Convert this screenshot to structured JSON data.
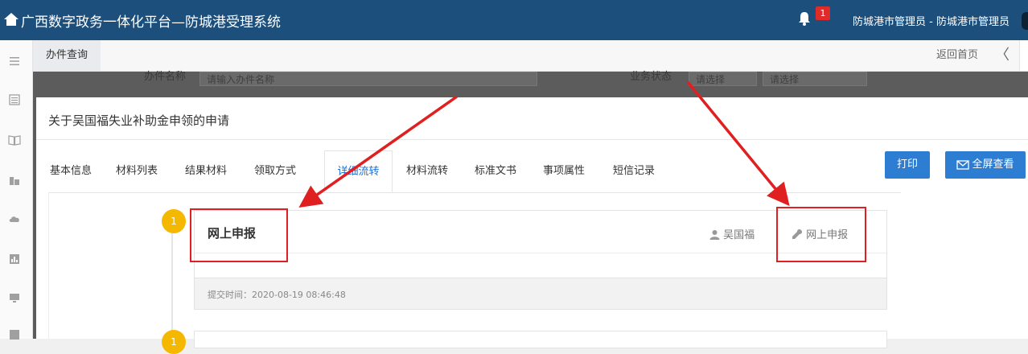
{
  "header": {
    "title": "广西数字政务一体化平台—防城港受理系统",
    "notification_count": "1",
    "user": "防城港市管理员 - 防城港市管理员"
  },
  "left_rail": {
    "icons": [
      "menu-icon",
      "list-icon",
      "book-icon",
      "building-icon",
      "cloud-icon",
      "chart-icon",
      "monitor-icon",
      "report-icon"
    ]
  },
  "tab_strip": {
    "active_tab": "办件查询",
    "home_link": "返回首页",
    "prev_arrow": "〈"
  },
  "background_form": {
    "name_label": "办件名称",
    "name_placeholder": "请输入办件名称",
    "status_label": "业务状态",
    "select_1": "请选择",
    "select_2": "请选择"
  },
  "modal": {
    "title": "关于吴国福失业补助金申领的申请",
    "tabs": [
      "基本信息",
      "材料列表",
      "结果材料",
      "领取方式",
      "详细流转",
      "材料流转",
      "标准文书",
      "事项属性",
      "短信记录"
    ],
    "active_tab_index": 4,
    "print_button": "打印",
    "fullscreen_button": "全屏查看"
  },
  "timeline": {
    "steps": [
      {
        "index": "1",
        "title": "网上申报",
        "user": "吴国福",
        "action": "网上申报",
        "submit_time": "提交时间：2020-08-19 08:46:48"
      },
      {
        "index": "1"
      }
    ]
  },
  "colors": {
    "header_bg": "#1c4f7c",
    "accent": "#2d7dd2",
    "badge": "#f5b800",
    "annotation": "#e02020"
  }
}
